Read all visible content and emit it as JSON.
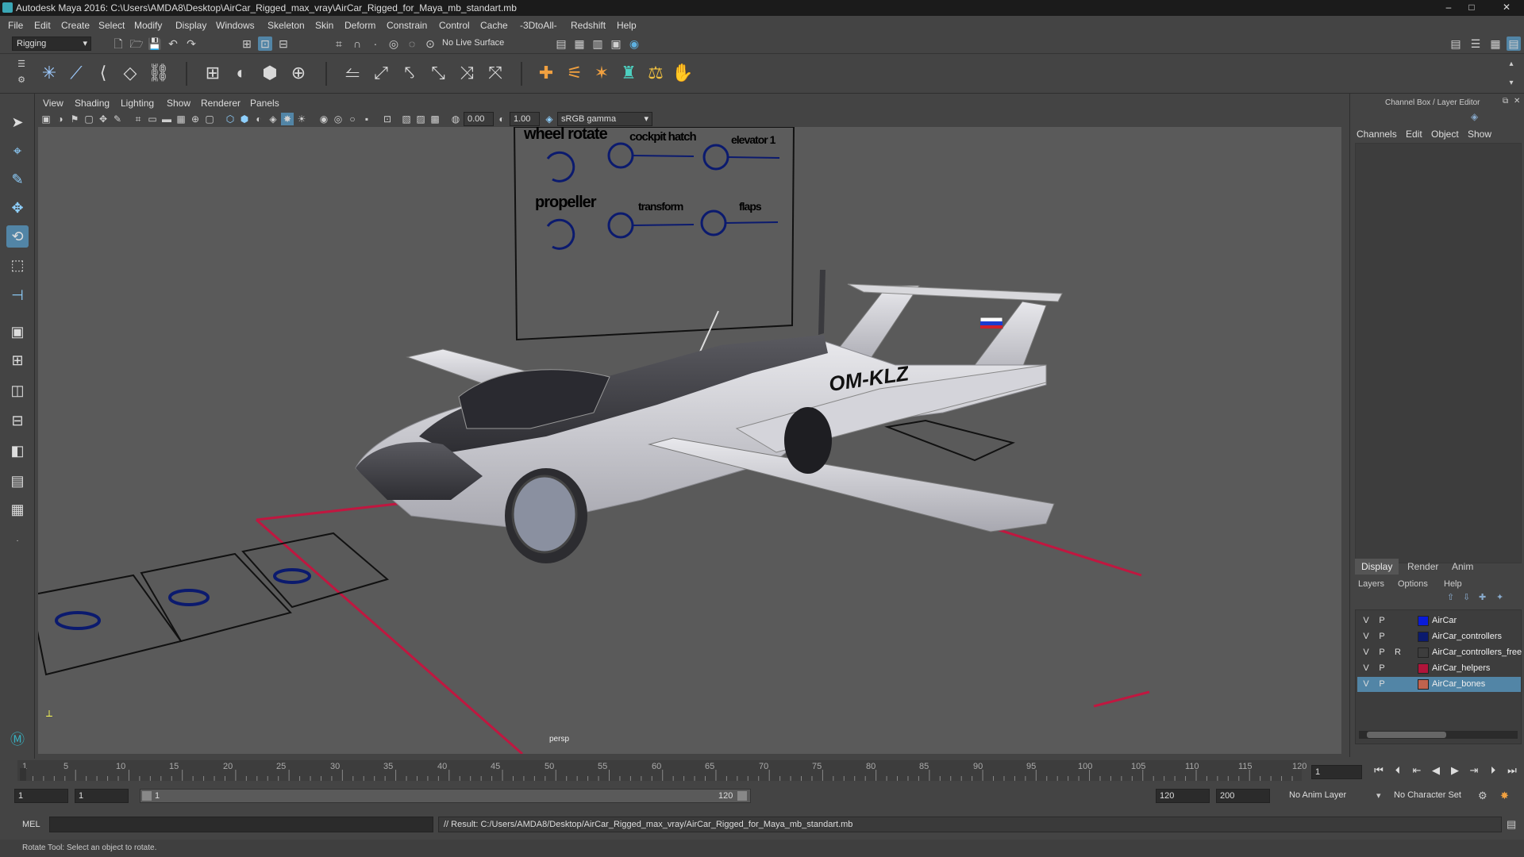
{
  "window": {
    "title": "Autodesk Maya 2016: C:\\Users\\AMDA8\\Desktop\\AirCar_Rigged_max_vray\\AirCar_Rigged_for_Maya_mb_standart.mb",
    "minimize": "–",
    "maximize": "□",
    "close": "✕"
  },
  "menus": [
    "File",
    "Edit",
    "Create",
    "Select",
    "Modify",
    "Display",
    "Windows",
    "Skeleton",
    "Skin",
    "Deform",
    "Constrain",
    "Control",
    "Cache",
    "-3DtoAll-",
    "Redshift",
    "Help"
  ],
  "statusline": {
    "mode": "Rigging",
    "live_surface": "No Live Surface"
  },
  "viewport": {
    "menus": [
      "View",
      "Shading",
      "Lighting",
      "Show",
      "Renderer",
      "Panels"
    ],
    "exposure": "0.00",
    "gamma": "1.00",
    "color_space": "sRGB gamma",
    "camera_label": "persp",
    "panel_labels": {
      "wheel_rotate": "wheel rotate",
      "cockpit_hatch": "cockpit hatch",
      "elevator": "elevator 1",
      "propeller": "propeller",
      "transform": "transform",
      "flaps": "flaps"
    },
    "registration": "OM-KLZ"
  },
  "channelbox": {
    "title": "Channel Box / Layer Editor",
    "tabs": [
      "Channels",
      "Edit",
      "Object",
      "Show"
    ],
    "layer_tabs": [
      "Display",
      "Render",
      "Anim"
    ],
    "layer_menus": [
      "Layers",
      "Options",
      "Help"
    ],
    "layers": [
      {
        "v": "V",
        "p": "P",
        "r": "",
        "name": "AirCar",
        "color": "#0a1bd8"
      },
      {
        "v": "V",
        "p": "P",
        "r": "",
        "name": "AirCar_controllers",
        "color": "#0b1a6e"
      },
      {
        "v": "V",
        "p": "P",
        "r": "R",
        "name": "AirCar_controllers_free",
        "color": "#3d3d3d"
      },
      {
        "v": "V",
        "p": "P",
        "r": "",
        "name": "AirCar_helpers",
        "color": "#b0143a"
      },
      {
        "v": "V",
        "p": "P",
        "r": "",
        "name": "AirCar_bones",
        "color": "#c0634e"
      }
    ]
  },
  "timeline": {
    "ticks": [
      "1",
      "5",
      "10",
      "15",
      "20",
      "25",
      "30",
      "35",
      "40",
      "45",
      "50",
      "55",
      "60",
      "65",
      "70",
      "75",
      "80",
      "85",
      "90",
      "95",
      "100",
      "105",
      "110",
      "115",
      "120"
    ],
    "current_frame": "1"
  },
  "range": {
    "start": "1",
    "playback_start": "1",
    "slider_start": "1",
    "slider_end": "120",
    "playback_end": "120",
    "end": "200",
    "anim_layer": "No Anim Layer",
    "character_set": "No Character Set"
  },
  "command": {
    "lang": "MEL",
    "result": "// Result: C:/Users/AMDA8/Desktop/AirCar_Rigged_max_vray/AirCar_Rigged_for_Maya_mb_standart.mb"
  },
  "help_line": "Rotate Tool: Select an object to rotate."
}
